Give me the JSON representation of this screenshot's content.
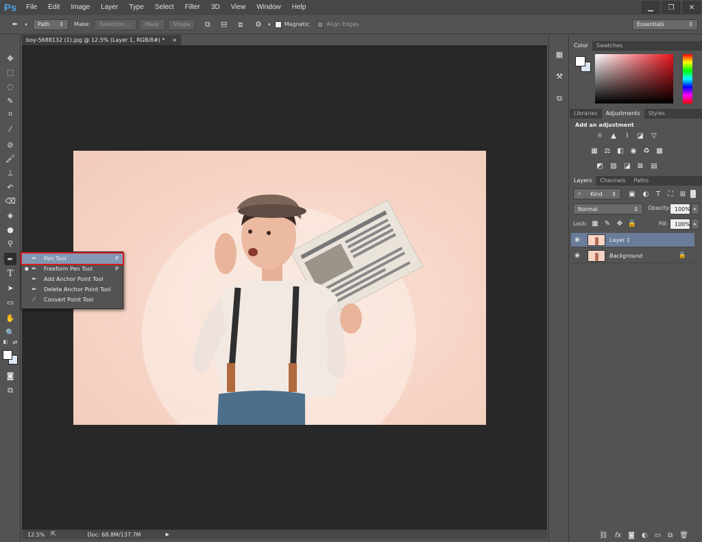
{
  "app": {
    "logo": "Ps"
  },
  "menu": [
    "File",
    "Edit",
    "Image",
    "Layer",
    "Type",
    "Select",
    "Filter",
    "3D",
    "View",
    "Window",
    "Help"
  ],
  "options_bar": {
    "mode": "Path",
    "make_label": "Make:",
    "selection_btn": "Selection...",
    "mask_btn": "Mask",
    "shape_btn": "Shape",
    "magnetic_label": "Magnetic",
    "align_edges_label": "Align Edges",
    "workspace": "Essentials"
  },
  "document": {
    "tab_title": "boy-5688132 (1).jpg @ 12.5% (Layer 1, RGB/8#) *",
    "tab_close": "×",
    "zoom": "12.5%",
    "doc_size": "Doc: 68.8M/137.7M"
  },
  "pen_flyout": {
    "items": [
      {
        "label": "Pen Tool",
        "shortcut": "P",
        "selected": true
      },
      {
        "label": "Freeform Pen Tool",
        "shortcut": "P",
        "selected": false
      },
      {
        "label": "Add Anchor Point Tool",
        "shortcut": "",
        "selected": false
      },
      {
        "label": "Delete Anchor Point Tool",
        "shortcut": "",
        "selected": false
      },
      {
        "label": "Convert Point Tool",
        "shortcut": "",
        "selected": false
      }
    ]
  },
  "color_panel": {
    "tabs": [
      "Color",
      "Swatches"
    ]
  },
  "adjustments_panel": {
    "tabs": [
      "Libraries",
      "Adjustments",
      "Styles"
    ],
    "heading": "Add an adjustment"
  },
  "layers_panel": {
    "tabs": [
      "Layers",
      "Channels",
      "Paths"
    ],
    "filter_kind": "Kind",
    "blend_mode": "Normal",
    "opacity_label": "Opacity:",
    "opacity_value": "100%",
    "lock_label": "Lock:",
    "fill_label": "Fill:",
    "fill_value": "100%",
    "layers": [
      {
        "name": "Layer 1",
        "selected": true
      },
      {
        "name": "Background",
        "selected": false
      }
    ]
  },
  "colors": {
    "menubar": "#474747",
    "canvas_bg": "#282828",
    "highlight": "#d81c1c",
    "selection": "#8497b4",
    "logo": "#4fa3e0"
  }
}
